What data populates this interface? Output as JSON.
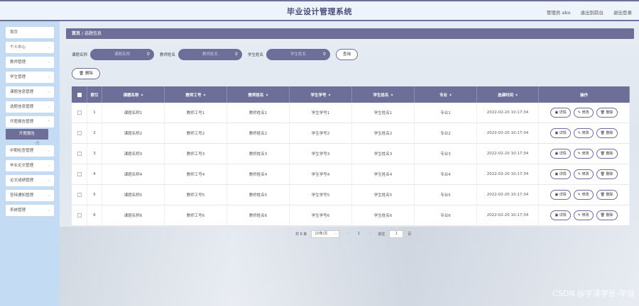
{
  "header": {
    "title": "毕业设计管理系统",
    "user_label": "管理员 abo",
    "back_label": "退出到前台",
    "logout_label": "退出登录"
  },
  "sidebar": {
    "items": [
      {
        "label": "首页",
        "arrow": false
      },
      {
        "label": "个人中心",
        "arrow": true
      },
      {
        "label": "教师管理",
        "arrow": true
      },
      {
        "label": "学生管理",
        "arrow": true
      },
      {
        "label": "课题信息管理",
        "arrow": true
      },
      {
        "label": "选题信息管理",
        "arrow": true
      },
      {
        "label": "开题报告管理",
        "arrow": true
      },
      {
        "label": "中期检查管理",
        "arrow": true
      },
      {
        "label": "毕业论文管理",
        "arrow": true
      },
      {
        "label": "论文成绩管理",
        "arrow": true
      },
      {
        "label": "答辩通知管理",
        "arrow": true
      },
      {
        "label": "系统管理",
        "arrow": true
      }
    ],
    "sub_item": "开题报告"
  },
  "breadcrumb": {
    "home": "首页",
    "sep": "/",
    "current": "选题信息"
  },
  "search": {
    "f1_label": "课题名称",
    "f1_placeholder": "课题名称",
    "f2_label": "教师姓名",
    "f2_placeholder": "教师姓名",
    "f3_label": "学生姓名",
    "f3_placeholder": "学生姓名",
    "query_label": "查询"
  },
  "toolbar": {
    "delete_label": "删除"
  },
  "table": {
    "headers": [
      "索引",
      "课题名称",
      "教师工号",
      "教师姓名",
      "学生学号",
      "学生姓名",
      "专业",
      "选课时间",
      "操作"
    ],
    "rows": [
      [
        "1",
        "课题名称1",
        "教师工号1",
        "教师姓名1",
        "学生学号1",
        "学生姓名1",
        "专业1",
        "2022-02-20 10:17:34"
      ],
      [
        "2",
        "课题名称2",
        "教师工号2",
        "教师姓名2",
        "学生学号2",
        "学生姓名2",
        "专业2",
        "2022-02-20 10:17:34"
      ],
      [
        "3",
        "课题名称3",
        "教师工号3",
        "教师姓名3",
        "学生学号3",
        "学生姓名3",
        "专业3",
        "2022-02-20 10:17:34"
      ],
      [
        "4",
        "课题名称4",
        "教师工号4",
        "教师姓名4",
        "学生学号4",
        "学生姓名4",
        "专业4",
        "2022-02-20 10:17:34"
      ],
      [
        "5",
        "课题名称5",
        "教师工号5",
        "教师姓名5",
        "学生学号5",
        "学生姓名5",
        "专业5",
        "2022-02-20 10:17:34"
      ],
      [
        "6",
        "课题名称6",
        "教师工号6",
        "教师姓名6",
        "学生学号6",
        "学生姓名6",
        "专业6",
        "2022-02-20 10:17:34"
      ]
    ],
    "actions": {
      "detail": "详情",
      "edit": "修改",
      "delete": "删除"
    }
  },
  "pager": {
    "total": "共 6 条",
    "size": "10条/页",
    "page": "1",
    "goto": "前往",
    "goto_value": "1",
    "page_unit": "页"
  },
  "watermark": "CSDN @宇泽学长-毕设",
  "colors": {
    "accent": "#6d6f98",
    "sidebar_bg": "#c3dbf3"
  }
}
